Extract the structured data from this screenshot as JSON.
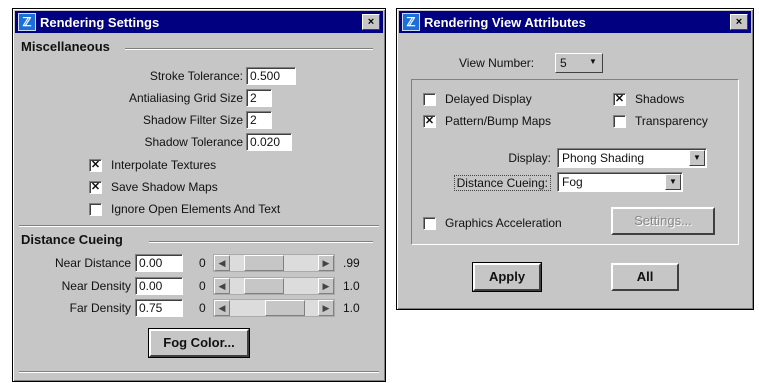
{
  "rendering_settings": {
    "title": "Rendering Settings",
    "close": "×",
    "misc": {
      "title": "Miscellaneous",
      "stroke_tolerance": {
        "label": "Stroke Tolerance:",
        "value": "0.500"
      },
      "antialiasing_grid": {
        "label": "Antialiasing Grid Size",
        "value": "2"
      },
      "shadow_filter": {
        "label": "Shadow Filter Size",
        "value": "2"
      },
      "shadow_tolerance": {
        "label": "Shadow Tolerance",
        "value": "0.020"
      },
      "interpolate_textures": {
        "label": "Interpolate Textures",
        "checked": true
      },
      "save_shadow_maps": {
        "label": "Save Shadow Maps",
        "checked": true
      },
      "ignore_open": {
        "label": "Ignore Open Elements And Text",
        "checked": false
      }
    },
    "distance": {
      "title": "Distance Cueing",
      "near_distance": {
        "label": "Near Distance",
        "value": "0.00",
        "min": "0",
        "max": ".99",
        "position": 0.3
      },
      "near_density": {
        "label": "Near Density",
        "value": "0.00",
        "min": "0",
        "max": "1.0",
        "position": 0.3
      },
      "far_density": {
        "label": "Far Density",
        "value": "0.75",
        "min": "0",
        "max": "1.0",
        "position": 0.72
      }
    },
    "fog_button": "Fog Color..."
  },
  "view_attributes": {
    "title": "Rendering View Attributes",
    "close": "×",
    "view_number": {
      "label": "View Number:",
      "value": "5"
    },
    "options": {
      "delayed_display": {
        "label": "Delayed Display",
        "checked": false
      },
      "shadows": {
        "label": "Shadows",
        "checked": true
      },
      "pattern_bump": {
        "label": "Pattern/Bump Maps",
        "checked": true
      },
      "transparency": {
        "label": "Transparency",
        "checked": false
      }
    },
    "display": {
      "label": "Display:",
      "value": "Phong Shading"
    },
    "distance_cueing": {
      "label": "Distance Cueing:",
      "value": "Fog"
    },
    "graphics_accel": {
      "label": "Graphics Acceleration",
      "checked": false
    },
    "settings_button": "Settings...",
    "apply_button": "Apply",
    "all_button": "All"
  },
  "colors": {
    "titlebar": "#000080",
    "dialog": "#c6c6c6"
  },
  "icons": [
    "app-icon",
    "close-icon",
    "checkbox-check-icon",
    "slider-left-arrow-icon",
    "slider-right-arrow-icon",
    "dropdown-arrow-icon"
  ]
}
